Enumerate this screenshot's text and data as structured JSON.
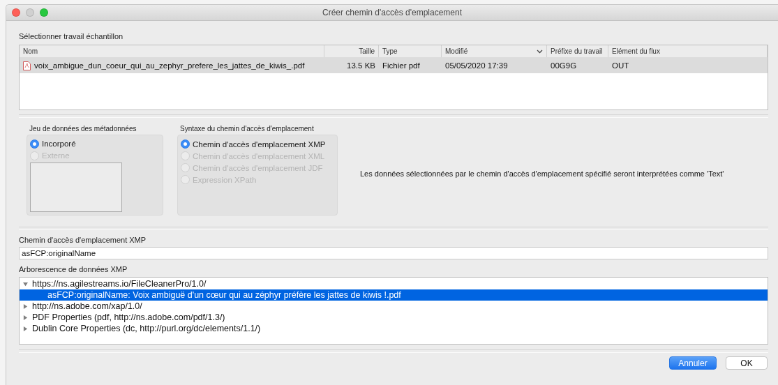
{
  "window": {
    "title": "Créer chemin d'accès d'emplacement"
  },
  "sample": {
    "label": "Sélectionner travail échantillon",
    "columns": [
      {
        "label": "Nom",
        "kind": "text",
        "sorted": false
      },
      {
        "label": "Taille",
        "kind": "number",
        "sorted": false
      },
      {
        "label": "Type",
        "kind": "text",
        "sorted": false
      },
      {
        "label": "Modifié",
        "kind": "text",
        "sorted": true
      },
      {
        "label": "Préfixe du travail",
        "kind": "text",
        "sorted": false
      },
      {
        "label": "Elément du flux",
        "kind": "text",
        "sorted": false
      }
    ],
    "rows": [
      {
        "selected": true,
        "cells": [
          "voix_ambigue_dun_coeur_qui_au_zephyr_prefere_les_jattes_de_kiwis_.pdf",
          "13.5 KB",
          "Fichier pdf",
          "05/05/2020 17:39",
          "00G9G",
          "OUT"
        ]
      }
    ]
  },
  "metadata_set": {
    "title": "Jeu de données des métadonnées",
    "options": [
      {
        "label": "Incorporé",
        "selected": true,
        "disabled": false
      },
      {
        "label": "Externe",
        "selected": false,
        "disabled": true
      }
    ]
  },
  "path_syntax": {
    "title": "Syntaxe du chemin d'accès d'emplacement",
    "options": [
      {
        "label": "Chemin d'accès d'emplacement XMP",
        "selected": true,
        "disabled": false
      },
      {
        "label": "Chemin d'accès d'emplacement XML",
        "selected": false,
        "disabled": true
      },
      {
        "label": "Chemin d'accès d'emplacement JDF",
        "selected": false,
        "disabled": true
      },
      {
        "label": "Expression XPath",
        "selected": false,
        "disabled": true
      }
    ]
  },
  "info": "Les données sélectionnées par le chemin d'accès d'emplacement spécifié seront interprétées comme 'Text'",
  "xmp_path": {
    "label": "Chemin d'accès d'emplacement XMP",
    "value": "asFCP:originalName"
  },
  "xmp_tree": {
    "label": "Arborescence de données XMP",
    "items": [
      {
        "label": "https://ns.agilestreams.io/FileCleanerPro/1.0/",
        "expanded": true,
        "selected": false,
        "children": [
          {
            "label": "asFCP:originalName: Voix ambiguë d'un cœur qui au zéphyr préfère les jattes de kiwis !.pdf",
            "selected": true
          }
        ]
      },
      {
        "label": "http://ns.adobe.com/xap/1.0/",
        "expanded": false,
        "selected": false
      },
      {
        "label": "PDF Properties (pdf, http://ns.adobe.com/pdf/1.3/)",
        "expanded": false,
        "selected": false
      },
      {
        "label": "Dublin Core Properties (dc, http://purl.org/dc/elements/1.1/)",
        "expanded": false,
        "selected": false
      }
    ]
  },
  "buttons": [
    {
      "label": "Annuler",
      "kind": "primary"
    },
    {
      "label": "OK",
      "kind": "default"
    }
  ]
}
